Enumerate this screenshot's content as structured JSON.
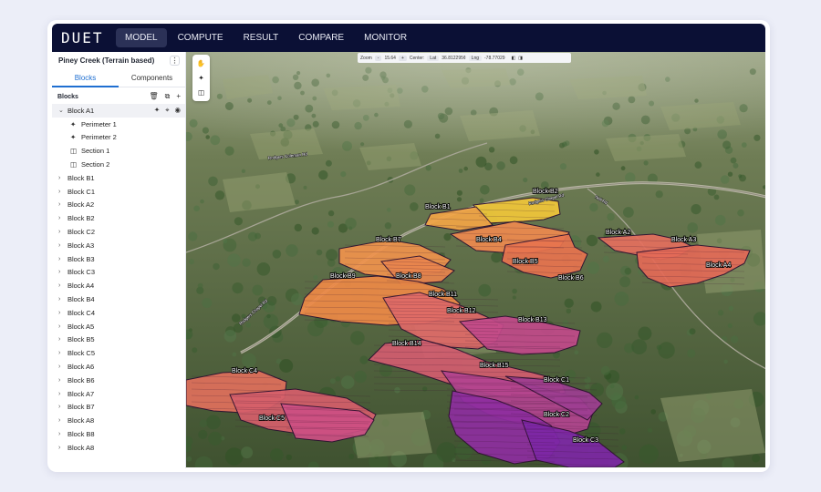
{
  "app": {
    "logo": "DUET",
    "nav": [
      "MODEL",
      "COMPUTE",
      "RESULT",
      "COMPARE",
      "MONITOR"
    ],
    "active_nav": "MODEL"
  },
  "sidebar": {
    "project_name": "Piney Creek (Terrain based)",
    "menu_glyph": "⋮",
    "tabs": [
      "Blocks",
      "Components"
    ],
    "active_tab": "Blocks",
    "blocks_header": "Blocks",
    "header_icons": [
      "trash-icon",
      "copy-icon",
      "plus-icon"
    ],
    "expanded_block": {
      "label": "Block A1",
      "icons": [
        "pin-edit-icon",
        "zoom-to-icon",
        "eye-icon"
      ],
      "children": [
        {
          "label": "Perimeter 1",
          "icon": "perimeter-icon"
        },
        {
          "label": "Perimeter 2",
          "icon": "perimeter-icon"
        },
        {
          "label": "Section 1",
          "icon": "section-icon"
        },
        {
          "label": "Section 2",
          "icon": "section-icon"
        }
      ]
    },
    "blocks": [
      "Block B1",
      "Block C1",
      "Block A2",
      "Block B2",
      "Block C2",
      "Block A3",
      "Block B3",
      "Block C3",
      "Block A4",
      "Block B4",
      "Block C4",
      "Block A5",
      "Block B5",
      "Block C5",
      "Block A6",
      "Block B6",
      "Block A7",
      "Block B7",
      "Block A8",
      "Block B8",
      "Block A8"
    ]
  },
  "map": {
    "zoom_label": "Zoom",
    "zoom_minus": "-",
    "zoom_value": "15.64",
    "zoom_plus": "+",
    "center_label": "Center:",
    "lat_label": "Lat",
    "lat_value": "36.812295¢",
    "lng_label": "Lng",
    "lng_value": "-78.77029",
    "tools": [
      "hand-icon",
      "pointer-icon",
      "grid-icon"
    ],
    "block_labels": [
      "Block B2",
      "Block B1",
      "Block B4",
      "Block B7",
      "Block B5",
      "Block B8",
      "Block B6",
      "Block A2",
      "Block A3",
      "Block A4",
      "Block B9",
      "Block B11",
      "Block B12",
      "Block B13",
      "Block B14",
      "Block B15",
      "Block C4",
      "Block C5",
      "Block C1",
      "Block C2",
      "Block C3"
    ],
    "road_labels": [
      "Rodgers Chapel Rd",
      "Rodgers Chapel Rd",
      "Rodgers Coleman Rd",
      "Nell Rd"
    ]
  }
}
